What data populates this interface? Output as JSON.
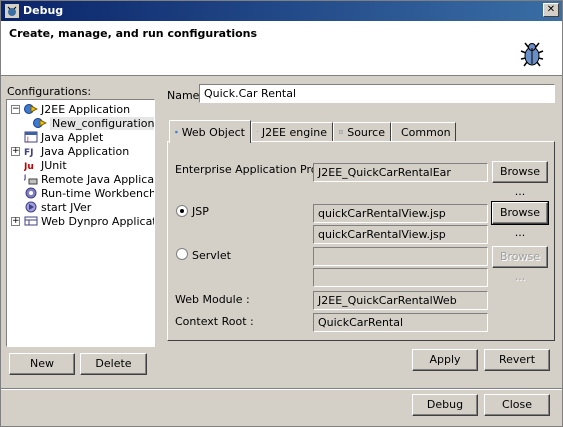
{
  "window": {
    "title": "Debug",
    "close_glyph": "✕"
  },
  "header": {
    "description": "Create, manage, and run configurations",
    "icon": "debug-bug-icon"
  },
  "left": {
    "configurations_label": "Configurations:",
    "tree": [
      {
        "label": "J2EE Application",
        "expander": "−",
        "icon": "j2ee-app-icon"
      },
      {
        "label": "New_configuration",
        "icon": "j2ee-config-icon",
        "selected": true
      },
      {
        "label": "Java Applet",
        "icon": "applet-icon"
      },
      {
        "label": "Java Application",
        "expander": "+",
        "icon": "java-app-icon"
      },
      {
        "label": "JUnit",
        "icon": "junit-icon"
      },
      {
        "label": "Remote Java Application",
        "icon": "remote-java-icon"
      },
      {
        "label": "Run-time Workbench",
        "icon": "workbench-icon"
      },
      {
        "label": "start JVer",
        "icon": "start-jver-icon"
      },
      {
        "label": "Web Dynpro Application",
        "expander": "+",
        "icon": "web-dynpro-icon"
      }
    ],
    "new_label": "New",
    "delete_label": "Delete"
  },
  "main": {
    "name_label": "Name:",
    "name_value": "Quick.Car Rental",
    "tabs": [
      {
        "label": "Web Object",
        "icon": "globe-icon",
        "active": true
      },
      {
        "label": "J2EE engine",
        "icon": "engine-icon"
      },
      {
        "label": "Source",
        "icon": "source-icon"
      },
      {
        "label": "Common",
        "icon": "common-gear-icon"
      }
    ],
    "enterprise_project_label": "Enterprise Application Project :",
    "enterprise_project_value": "J2EE_QuickCarRentalEar",
    "browse_label": "Browse ...",
    "jsp_label": "JSP",
    "jsp_value_1": "quickCarRentalView.jsp",
    "jsp_value_2": "quickCarRentalView.jsp",
    "servlet_label": "Servlet",
    "servlet_value_1": "",
    "servlet_value_2": "",
    "web_module_label": "Web Module :",
    "web_module_value": "J2EE_QuickCarRentalWeb",
    "context_root_label": "Context Root :",
    "context_root_value": "QuickCarRental",
    "selected_radio": "JSP"
  },
  "footer": {
    "apply_label": "Apply",
    "revert_label": "Revert",
    "debug_label": "Debug",
    "close_label": "Close"
  }
}
